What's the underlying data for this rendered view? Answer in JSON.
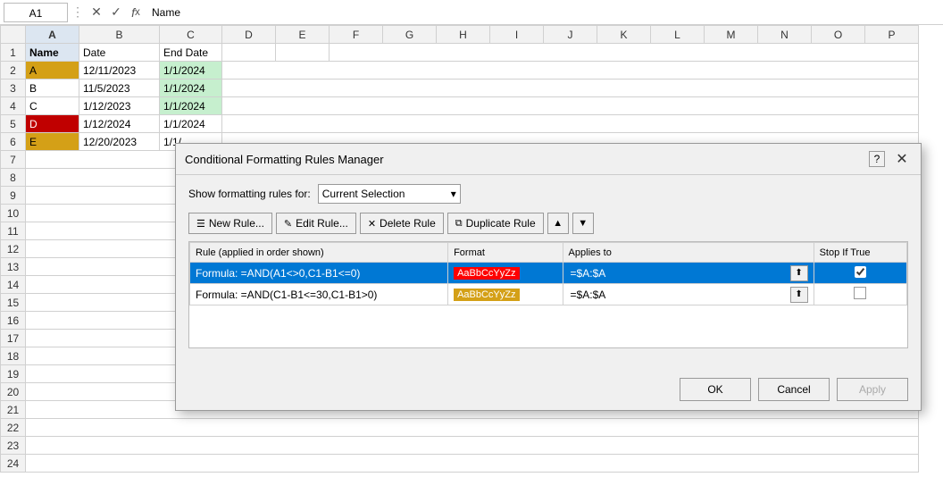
{
  "formulaBar": {
    "cellRef": "A1",
    "formulaValue": "Name"
  },
  "columns": [
    "A",
    "B",
    "C",
    "D",
    "E",
    "F",
    "G",
    "H",
    "I",
    "J",
    "K",
    "L",
    "M",
    "N",
    "O",
    "P"
  ],
  "rows": [
    {
      "rowNum": 1,
      "cells": [
        "Name",
        "Date",
        "End Date",
        "",
        "",
        "",
        "",
        "",
        "",
        "",
        "",
        "",
        "",
        "",
        "",
        ""
      ]
    },
    {
      "rowNum": 2,
      "cells": [
        "A",
        "12/11/2023",
        "1/1/2024",
        "",
        "",
        "",
        "",
        "",
        "",
        "",
        "",
        "",
        "",
        "",
        "",
        ""
      ],
      "aStyle": "gold"
    },
    {
      "rowNum": 3,
      "cells": [
        "B",
        "11/5/2023",
        "1/1/2024",
        "",
        "",
        "",
        "",
        "",
        "",
        "",
        "",
        "",
        "",
        "",
        "",
        ""
      ]
    },
    {
      "rowNum": 4,
      "cells": [
        "C",
        "1/12/2023",
        "1/1/2024",
        "",
        "",
        "",
        "",
        "",
        "",
        "",
        "",
        "",
        "",
        "",
        "",
        ""
      ]
    },
    {
      "rowNum": 5,
      "cells": [
        "D",
        "1/12/2024",
        "1/1/2024",
        "",
        "",
        "",
        "",
        "",
        "",
        "",
        "",
        "",
        "",
        "",
        "",
        ""
      ],
      "aStyle": "red"
    },
    {
      "rowNum": 6,
      "cells": [
        "E",
        "12/20/2023",
        "1/1/",
        "",
        "",
        "",
        "",
        "",
        "",
        "",
        "",
        "",
        "",
        "",
        "",
        ""
      ],
      "aStyle": "gold"
    },
    {
      "rowNum": 7,
      "cells": [
        "",
        "",
        "",
        "",
        "",
        "",
        "",
        "",
        "",
        "",
        "",
        "",
        "",
        "",
        "",
        ""
      ]
    },
    {
      "rowNum": 8,
      "cells": [
        "",
        "",
        "",
        "",
        "",
        "",
        "",
        "",
        "",
        "",
        "",
        "",
        "",
        "",
        "",
        ""
      ]
    }
  ],
  "dialog": {
    "title": "Conditional Formatting Rules Manager",
    "showRulesLabel": "Show formatting rules for:",
    "currentSelection": "Current Selection",
    "toolbar": {
      "newRule": "New Rule...",
      "editRule": "Edit Rule...",
      "deleteRule": "Delete Rule",
      "duplicateRule": "Duplicate Rule"
    },
    "tableHeaders": {
      "rule": "Rule (applied in order shown)",
      "format": "Format",
      "appliesTo": "Applies to",
      "stopIfTrue": "Stop If True"
    },
    "rules": [
      {
        "formula": "Formula: =AND(A1<>0,C1-B1<=0)",
        "formatLabel": "AaBbCcYyZz",
        "formatStyle": "red",
        "appliesTo": "=$A:$A",
        "stopIfTrue": true,
        "selected": true
      },
      {
        "formula": "Formula: =AND(C1-B1<=30,C1-B1>0)",
        "formatLabel": "AaBbCcYyZz",
        "formatStyle": "gold",
        "appliesTo": "=$A:$A",
        "stopIfTrue": false,
        "selected": false
      }
    ],
    "footer": {
      "ok": "OK",
      "cancel": "Cancel",
      "apply": "Apply"
    }
  }
}
